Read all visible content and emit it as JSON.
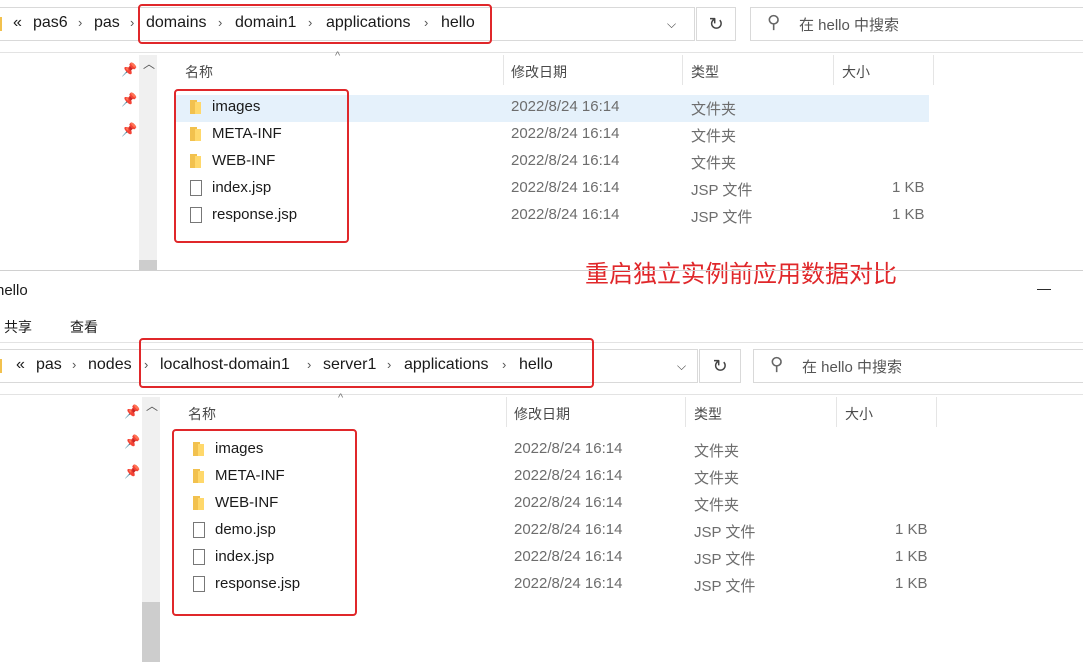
{
  "top_window": {
    "breadcrumb_prefix": "«",
    "breadcrumb": [
      "pas6",
      "pas",
      "domains",
      "domain1",
      "applications",
      "hello"
    ],
    "search_placeholder": "在 hello 中搜索",
    "columns": {
      "name": "名称",
      "date": "修改日期",
      "type": "类型",
      "size": "大小"
    },
    "rows": [
      {
        "name": "images",
        "date": "2022/8/24 16:14",
        "type": "文件夹",
        "size": "",
        "icon": "folder-icon"
      },
      {
        "name": "META-INF",
        "date": "2022/8/24 16:14",
        "type": "文件夹",
        "size": "",
        "icon": "folder-icon"
      },
      {
        "name": "WEB-INF",
        "date": "2022/8/24 16:14",
        "type": "文件夹",
        "size": "",
        "icon": "folder-icon"
      },
      {
        "name": "index.jsp",
        "date": "2022/8/24 16:14",
        "type": "JSP 文件",
        "size": "1 KB",
        "icon": "file-icon"
      },
      {
        "name": "response.jsp",
        "date": "2022/8/24 16:14",
        "type": "JSP 文件",
        "size": "1 KB",
        "icon": "file-icon"
      }
    ]
  },
  "annotation": "重启独立实例前应用数据对比",
  "bottom_window": {
    "title": "hello",
    "minimize_glyph": "—",
    "ribbon_tabs": [
      "共享",
      "查看"
    ],
    "breadcrumb_prefix": "«",
    "breadcrumb": [
      "pas",
      "nodes",
      "localhost-domain1",
      "server1",
      "applications",
      "hello"
    ],
    "search_placeholder": "在 hello 中搜索",
    "columns": {
      "name": "名称",
      "date": "修改日期",
      "type": "类型",
      "size": "大小"
    },
    "rows": [
      {
        "name": "images",
        "date": "2022/8/24 16:14",
        "type": "文件夹",
        "size": "",
        "icon": "folder-icon"
      },
      {
        "name": "META-INF",
        "date": "2022/8/24 16:14",
        "type": "文件夹",
        "size": "",
        "icon": "folder-icon"
      },
      {
        "name": "WEB-INF",
        "date": "2022/8/24 16:14",
        "type": "文件夹",
        "size": "",
        "icon": "folder-icon"
      },
      {
        "name": "demo.jsp",
        "date": "2022/8/24 16:14",
        "type": "JSP 文件",
        "size": "1 KB",
        "icon": "file-icon"
      },
      {
        "name": "index.jsp",
        "date": "2022/8/24 16:14",
        "type": "JSP 文件",
        "size": "1 KB",
        "icon": "file-icon"
      },
      {
        "name": "response.jsp",
        "date": "2022/8/24 16:14",
        "type": "JSP 文件",
        "size": "1 KB",
        "icon": "file-icon"
      }
    ]
  },
  "colors": {
    "highlight": "#e0272a",
    "selected_row": "#e5f1fb",
    "folder": "#f2c14e"
  }
}
